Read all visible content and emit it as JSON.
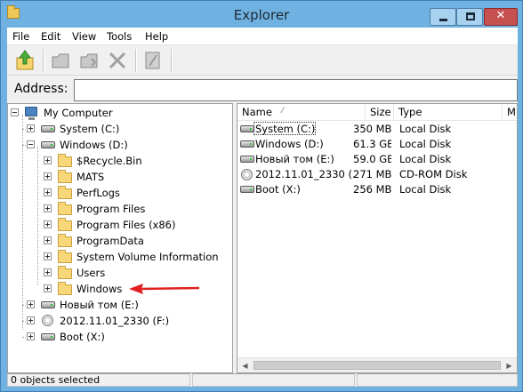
{
  "window": {
    "title": "Explorer",
    "buttons": {
      "minimize": "minimize",
      "maximize": "maximize",
      "close": "✕"
    }
  },
  "menu": {
    "items": [
      {
        "label": "File"
      },
      {
        "label": "Edit"
      },
      {
        "label": "View"
      },
      {
        "label": "Tools"
      },
      {
        "label": "Help"
      }
    ]
  },
  "toolbar": {
    "icons": [
      "folder-up-icon",
      "cut-icon",
      "copy-icon",
      "delete-icon",
      "properties-icon"
    ]
  },
  "address": {
    "label": "Address:",
    "value": ""
  },
  "tree": {
    "root": "My Computer",
    "items": [
      {
        "label": "System (C:)",
        "icon": "drive-icon",
        "expand": "+"
      },
      {
        "label": "Windows (D:)",
        "icon": "drive-icon",
        "expand": "-"
      },
      {
        "label": "$Recycle.Bin",
        "icon": "folder-icon",
        "expand": "+"
      },
      {
        "label": "MATS",
        "icon": "folder-icon",
        "expand": "+"
      },
      {
        "label": "PerfLogs",
        "icon": "folder-icon",
        "expand": "+"
      },
      {
        "label": "Program Files",
        "icon": "folder-icon",
        "expand": "+"
      },
      {
        "label": "Program Files (x86)",
        "icon": "folder-icon",
        "expand": "+"
      },
      {
        "label": "ProgramData",
        "icon": "folder-icon",
        "expand": "+"
      },
      {
        "label": "System Volume Information",
        "icon": "folder-icon",
        "expand": "+"
      },
      {
        "label": "Users",
        "icon": "folder-icon",
        "expand": "+"
      },
      {
        "label": "Windows",
        "icon": "folder-icon",
        "expand": "+"
      },
      {
        "label": "Новый том (E:)",
        "icon": "drive-icon",
        "expand": "+"
      },
      {
        "label": "2012.11.01_2330 (F:)",
        "icon": "cd-icon",
        "expand": "+"
      },
      {
        "label": "Boot (X:)",
        "icon": "drive-icon",
        "expand": "+"
      }
    ]
  },
  "list": {
    "columns": [
      {
        "label": "Name"
      },
      {
        "label": "Size"
      },
      {
        "label": "Type"
      },
      {
        "label": "M"
      }
    ],
    "sort_indicator": "⁄",
    "rows": [
      {
        "name": "System (C:)",
        "size": "350 MB",
        "type": "Local Disk",
        "icon": "drive-icon"
      },
      {
        "name": "Windows (D:)",
        "size": "61.3 GB",
        "type": "Local Disk",
        "icon": "drive-icon"
      },
      {
        "name": "Новый том (E:)",
        "size": "59.0 GB",
        "type": "Local Disk",
        "icon": "drive-icon"
      },
      {
        "name": "2012.11.01_2330 (...",
        "size": "271 MB",
        "type": "CD-ROM Disk",
        "icon": "cd-icon"
      },
      {
        "name": "Boot (X:)",
        "size": "256 MB",
        "type": "Local Disk",
        "icon": "drive-icon"
      }
    ],
    "scroll": {
      "left": "◀",
      "right": "▶"
    }
  },
  "status": {
    "text": "0 objects selected",
    "cell2": "",
    "cell3": ""
  },
  "annotation": {
    "arrow_color": "#e0201e",
    "points_to": "Windows"
  },
  "colors": {
    "titlebar": "#6fb1e0",
    "close_button": "#c75050",
    "folder": "#f7d777"
  }
}
